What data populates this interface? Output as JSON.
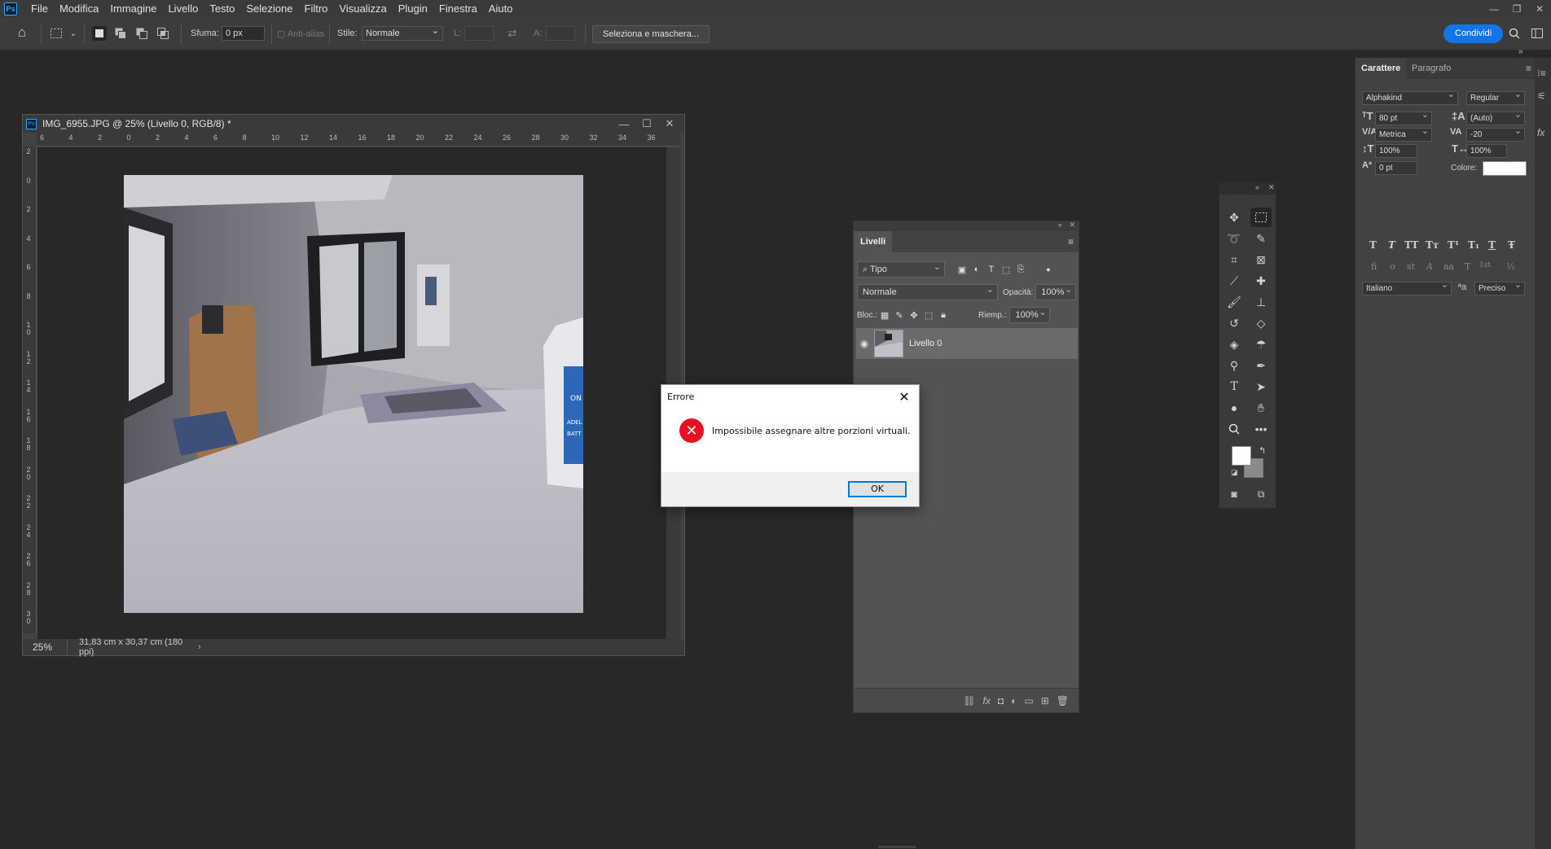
{
  "app": {
    "logo": "Ps"
  },
  "menu": [
    "File",
    "Modifica",
    "Immagine",
    "Livello",
    "Testo",
    "Selezione",
    "Filtro",
    "Visualizza",
    "Plugin",
    "Finestra",
    "Aiuto"
  ],
  "optionsbar": {
    "sfuma_label": "Sfuma:",
    "sfuma_value": "0 px",
    "antialias_label": "Anti-alias",
    "stile_label": "Stile:",
    "stile_value": "Normale",
    "width_label": "L:",
    "height_label": "A:",
    "select_mask_button": "Seleziona e maschera...",
    "share_button": "Condividi"
  },
  "document": {
    "title": "IMG_6955.JPG @ 25% (Livello 0, RGB/8) *",
    "zoom": "25%",
    "doc_info": "31,83 cm x 30,37 cm (180 ppi)",
    "ruler_top": [
      "6",
      "4",
      "2",
      "0",
      "2",
      "4",
      "6",
      "8",
      "10",
      "12",
      "14",
      "16",
      "18",
      "20",
      "22",
      "24",
      "26",
      "28",
      "30",
      "32",
      "34",
      "36"
    ],
    "ruler_left": [
      "2",
      "0",
      "2",
      "4",
      "6",
      "8",
      "1\n0",
      "1\n2",
      "1\n4",
      "1\n6",
      "1\n8",
      "2\n0",
      "2\n2",
      "2\n4",
      "2\n6",
      "2\n8",
      "3\n0"
    ]
  },
  "layers_panel": {
    "tab": "Livelli",
    "filter_kind": "Tipo",
    "blend_mode": "Normale",
    "opacity_label": "Opacità:",
    "opacity_value": "100%",
    "lock_label": "Bloc.:",
    "fill_label": "Riemp.:",
    "fill_value": "100%",
    "layers": [
      {
        "name": "Livello 0",
        "visible": true
      }
    ]
  },
  "character_panel": {
    "tab_character": "Carattere",
    "tab_paragraph": "Paragrafo",
    "font_family": "Alphakind",
    "font_style": "Regular",
    "font_size": "80 pt",
    "leading": "(Auto)",
    "kerning": "Metrica",
    "tracking": "-20",
    "vertical_scale": "100%",
    "horizontal_scale": "100%",
    "baseline_shift": "0 pt",
    "color_label": "Colore:",
    "color_value": "#ffffff",
    "language": "Italiano",
    "antialias": "Preciso",
    "style_glyphs": [
      "T",
      "T",
      "TT",
      "Tт",
      "T¹",
      "T₁",
      "T",
      "Ŧ"
    ],
    "opentype_glyphs": [
      "fi",
      "ơ",
      "st",
      "A",
      "aa",
      "T",
      "1st",
      "½"
    ]
  },
  "dialog": {
    "title": "Errore",
    "message": "Impossibile assegnare altre porzioni virtuali.",
    "ok_label": "OK"
  },
  "colors": {
    "foreground": "#ffffff",
    "background": "#8a8a8a",
    "accent": "#1473e6",
    "error": "#e81123"
  }
}
